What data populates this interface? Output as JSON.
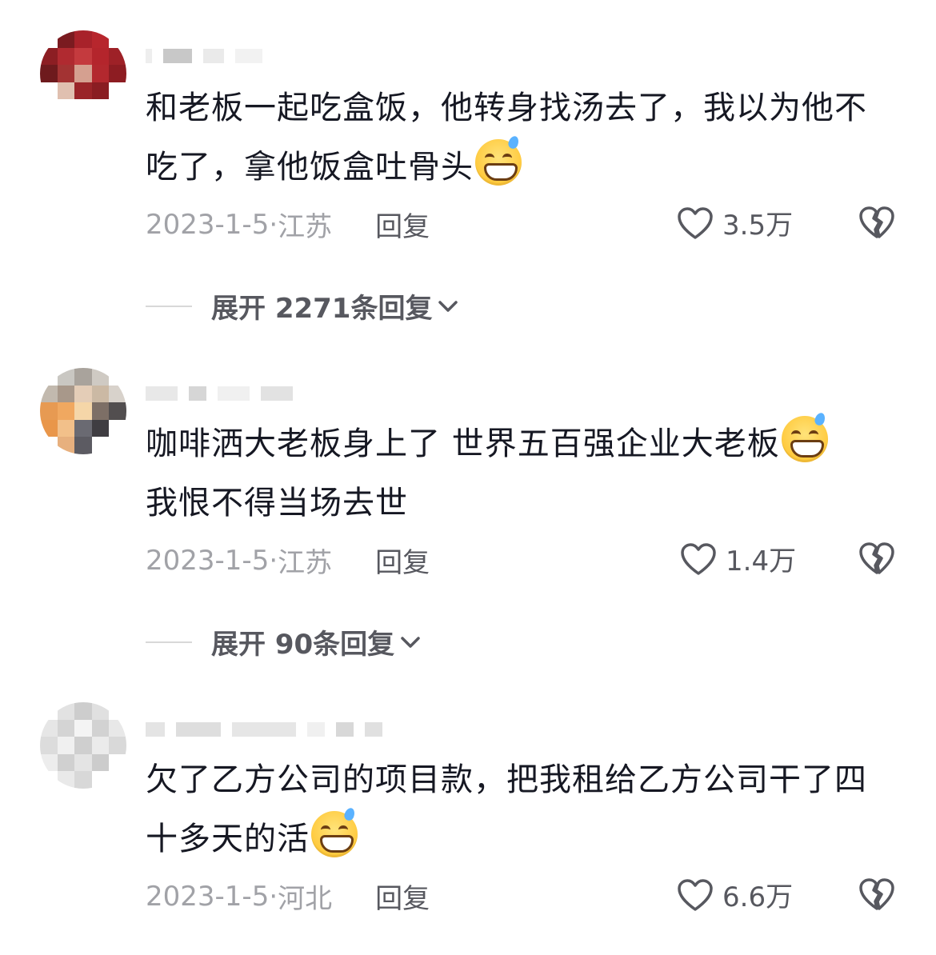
{
  "comments": [
    {
      "text": "和老板一起吃盒饭，他转身找汤去了，我以为他不吃了，拿他饭盒吐骨头",
      "date": "2023-1-5",
      "location": "江苏",
      "reply_label": "回复",
      "likes": "3.5万",
      "expand_label": "展开 2271条回复",
      "emoji": "grinning-sweat-emoji"
    },
    {
      "text_line1": "咖啡洒大老板身上了 世界五百强企业大老板",
      "text_line2": "我恨不得当场去世",
      "date": "2023-1-5",
      "location": "江苏",
      "reply_label": "回复",
      "likes": "1.4万",
      "expand_label": "展开 90条回复",
      "emoji": "grinning-sweat-emoji"
    },
    {
      "text": "欠了乙方公司的项目款，把我租给乙方公司干了四十多天的活",
      "date": "2023-1-5",
      "location": "河北",
      "reply_label": "回复",
      "likes": "6.6万",
      "emoji": "grinning-sweat-emoji"
    }
  ],
  "colors": {
    "text": "#161823",
    "meta": "#a1a2a7",
    "secondary": "#57585f"
  },
  "icons": {
    "like": "heart-outline-icon",
    "dislike": "broken-heart-icon",
    "expand": "chevron-down-icon"
  }
}
